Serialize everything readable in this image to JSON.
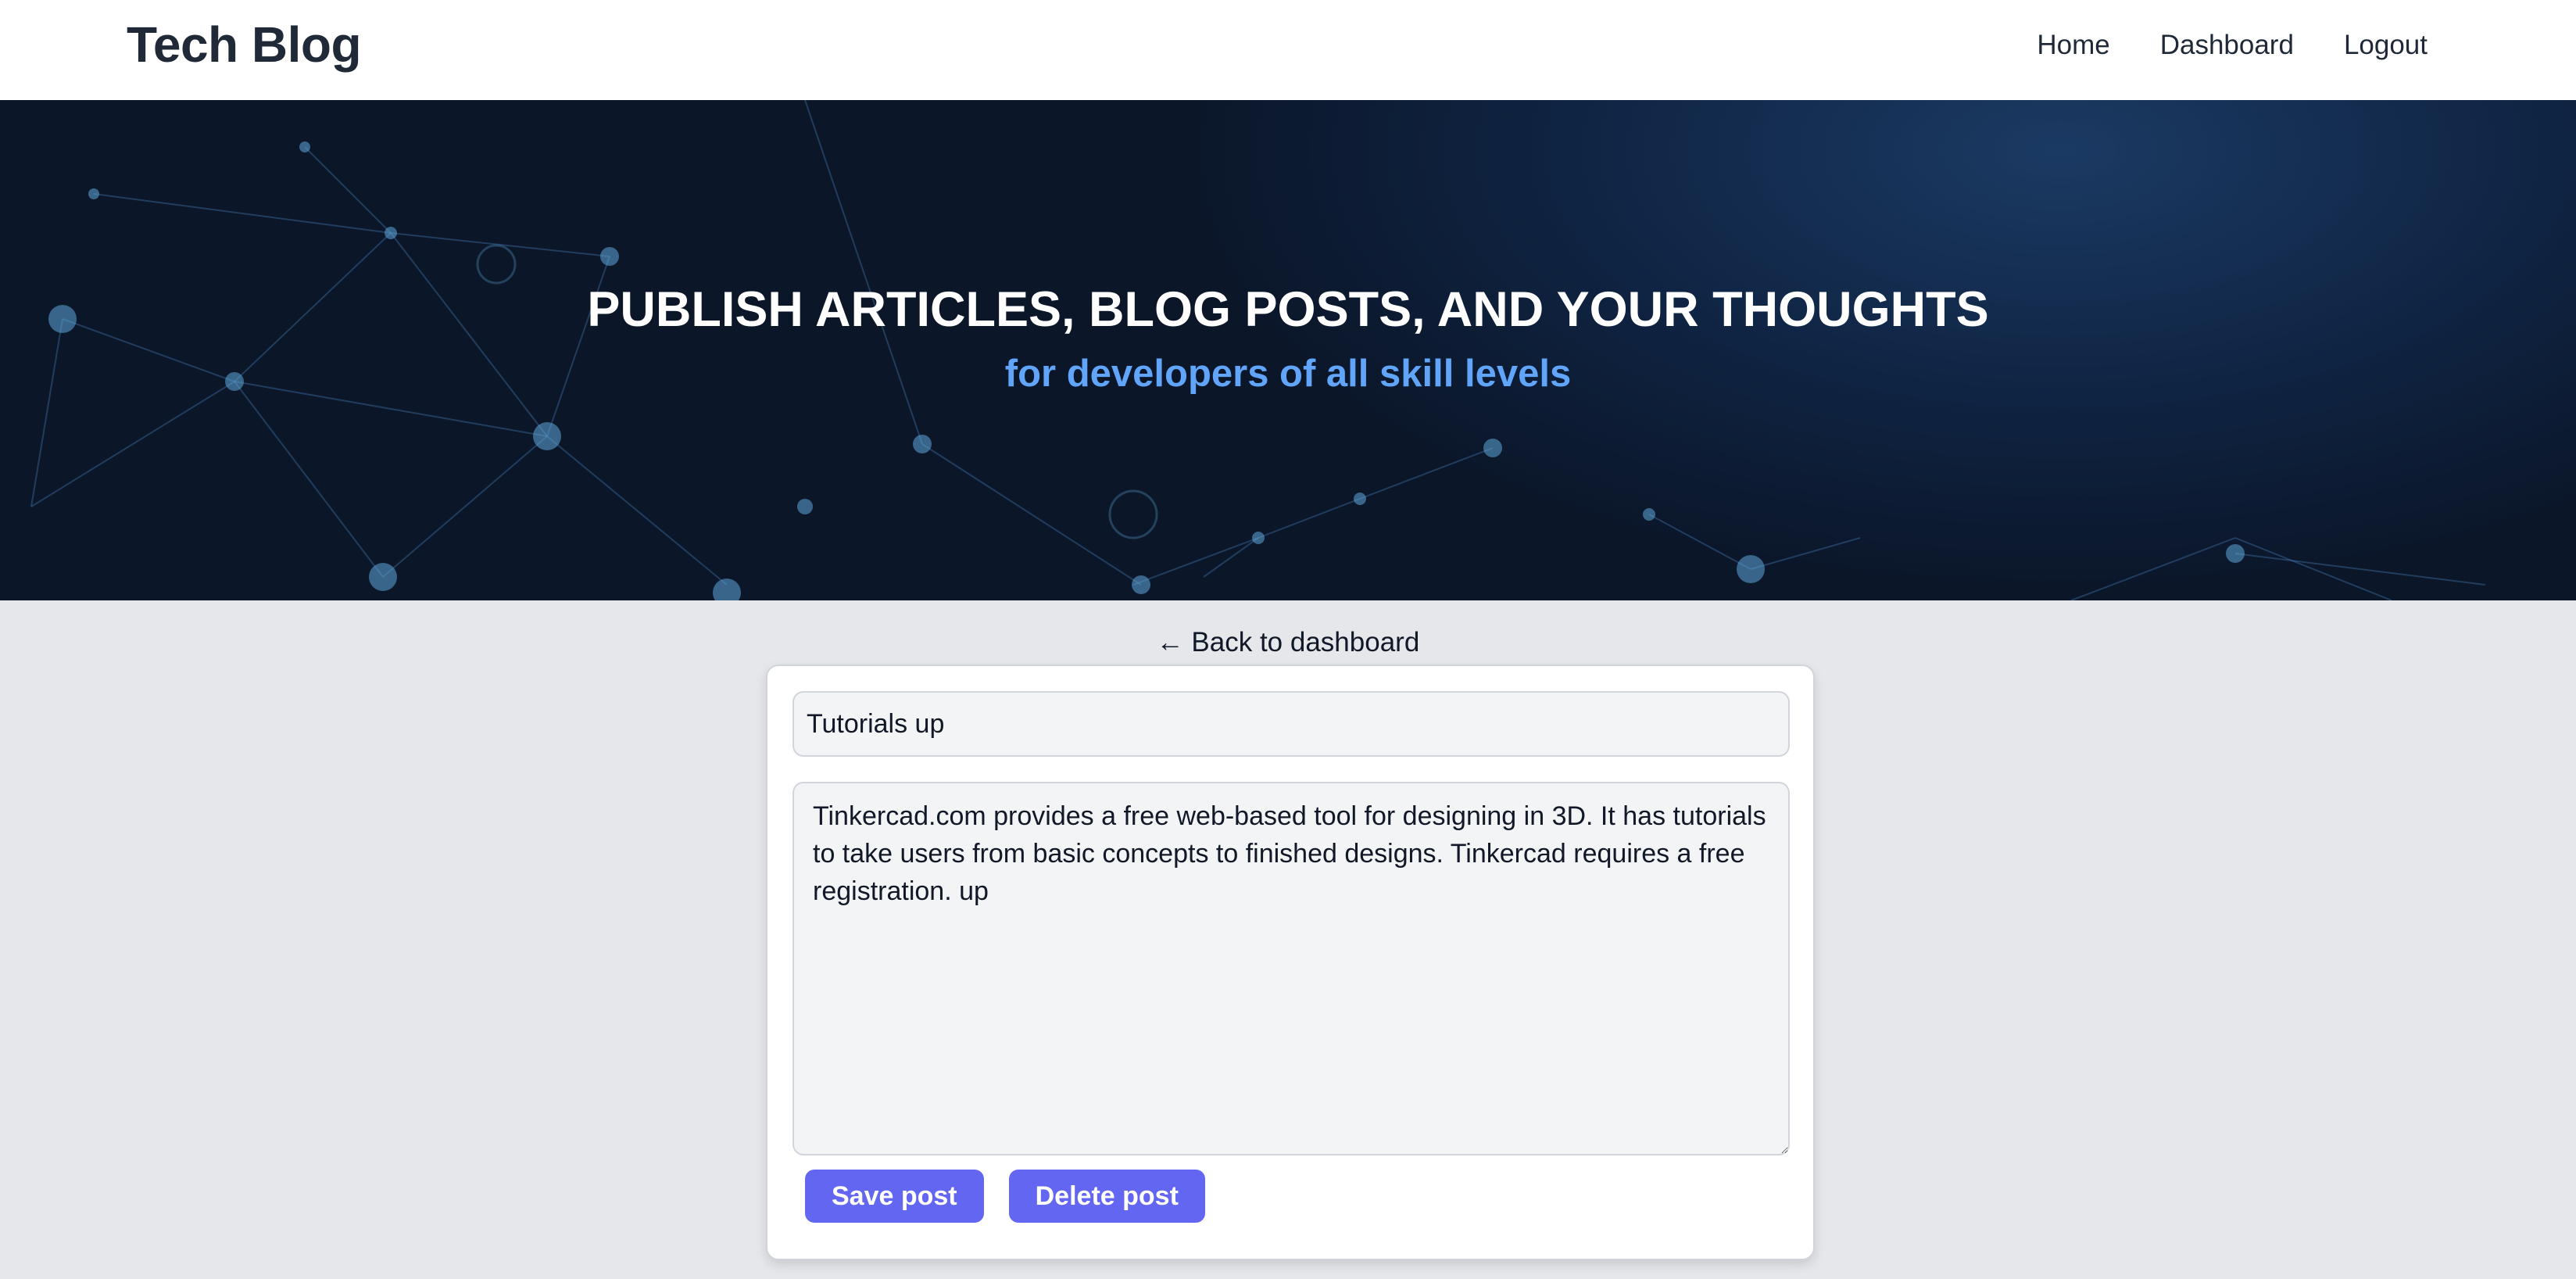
{
  "header": {
    "brand": "Tech Blog",
    "nav": [
      {
        "label": "Home"
      },
      {
        "label": "Dashboard"
      },
      {
        "label": "Logout"
      }
    ]
  },
  "hero": {
    "title": "PUBLISH ARTICLES, BLOG POSTS, AND YOUR THOUGHTS",
    "subtitle": "for developers of all skill levels"
  },
  "editor": {
    "back_link": "← Back to dashboard",
    "post_title_value": "Tutorials up",
    "post_body_value": "Tinkercad.com provides a free web-based tool for designing in 3D. It has tutorials to take users from basic concepts to finished designs. Tinkercad requires a free registration. up",
    "save_label": "Save post",
    "delete_label": "Delete post"
  },
  "colors": {
    "accent": "#6366f1",
    "subtitle": "#60a5fa",
    "page_bg": "#e5e7eb"
  }
}
